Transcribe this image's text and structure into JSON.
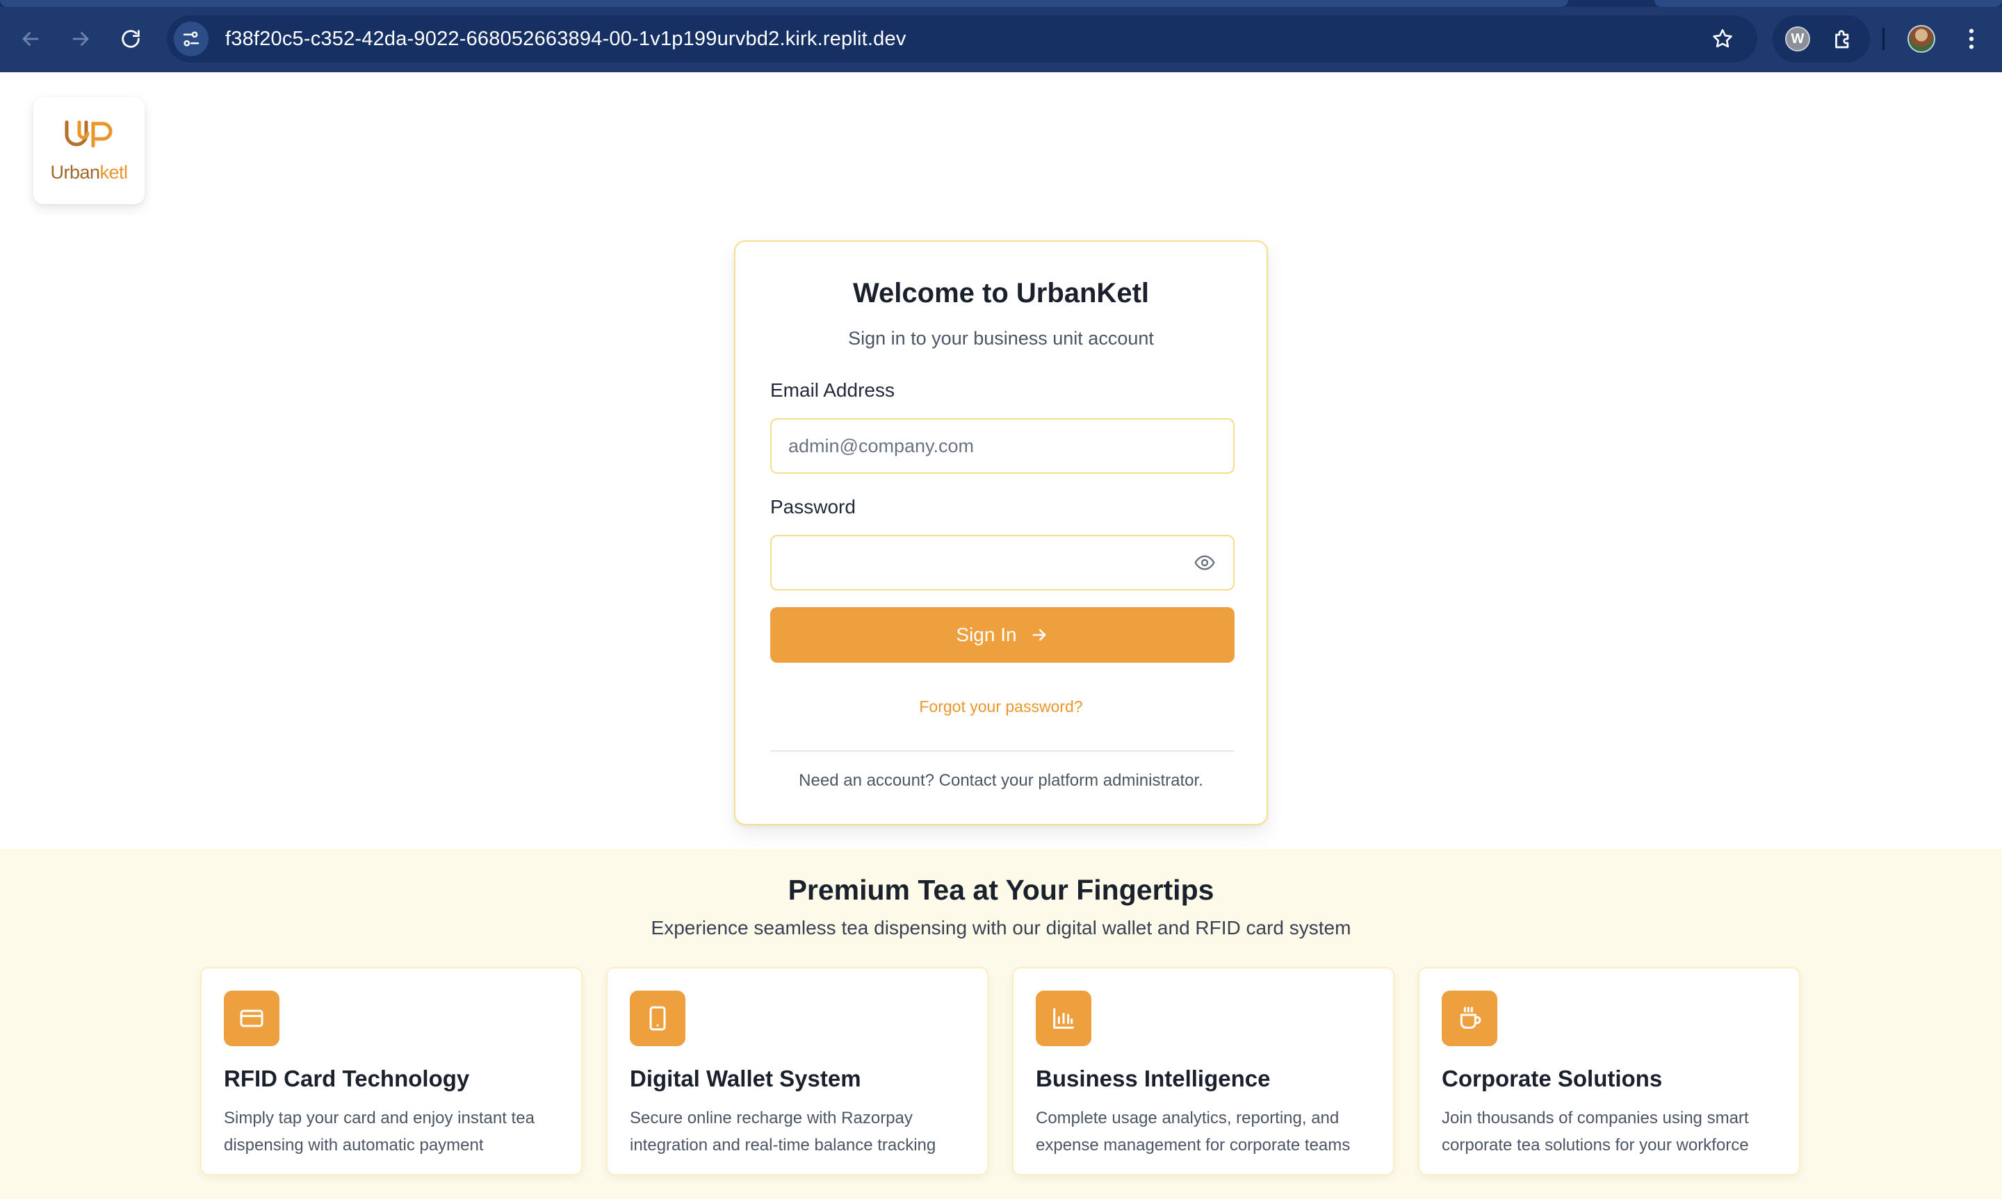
{
  "browser": {
    "url": "f38f20c5-c352-42da-9022-668052663894-00-1v1p199urvbd2.kirk.replit.dev",
    "extension_badge": "W",
    "theme_color": "#1f3a6e"
  },
  "logo": {
    "word_part1": "Urban",
    "word_part2": "ketl",
    "primary_color": "#a0662a",
    "accent_color": "#e9962b"
  },
  "login": {
    "title": "Welcome to UrbanKetl",
    "subtitle": "Sign in to your business unit account",
    "email_label": "Email Address",
    "email_placeholder": "admin@company.com",
    "email_value": "",
    "password_label": "Password",
    "password_value": "",
    "signin_label": "Sign In",
    "forgot_label": "Forgot your password?",
    "footer_text": "Need an account? Contact your platform administrator.",
    "button_color": "#eda03d"
  },
  "features": {
    "title": "Premium Tea at Your Fingertips",
    "subtitle": "Experience seamless tea dispensing with our digital wallet and RFID card system",
    "items": [
      {
        "icon": "credit-card-icon",
        "title": "RFID Card Technology",
        "desc_line1": "Simply tap your card and enjoy instant tea",
        "desc_line2": "dispensing with automatic payment"
      },
      {
        "icon": "smartphone-icon",
        "title": "Digital Wallet System",
        "desc_line1": "Secure online recharge with Razorpay",
        "desc_line2": "integration and real-time balance tracking"
      },
      {
        "icon": "bar-chart-icon",
        "title": "Business Intelligence",
        "desc_line1": "Complete usage analytics, reporting, and",
        "desc_line2": "expense management for corporate teams"
      },
      {
        "icon": "coffee-cup-icon",
        "title": "Corporate Solutions",
        "desc_line1": "Join thousands of companies using smart",
        "desc_line2": "corporate tea solutions for your workforce"
      }
    ]
  }
}
